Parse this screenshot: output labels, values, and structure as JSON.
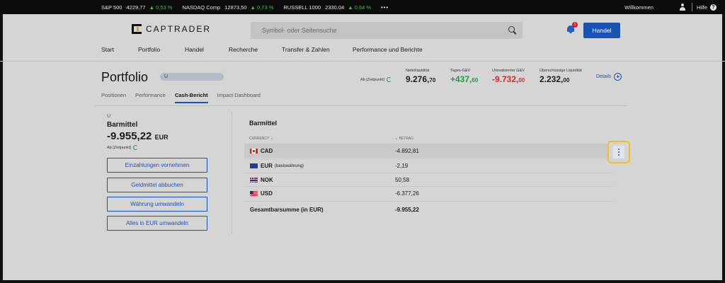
{
  "ticker": {
    "items": [
      {
        "name": "S&P 500",
        "value": "4229,77",
        "change": "▲ 0,53 %"
      },
      {
        "name": "NASDAQ Comp",
        "value": "12873,50",
        "change": "▲ 0,73 %"
      },
      {
        "name": "RUSSELL 1000",
        "value": "2330,04",
        "change": "▲ 0,54 %"
      }
    ],
    "more": "•••",
    "welcome": "Willkommen",
    "help": "Hilfe",
    "help_icon": "?"
  },
  "header": {
    "logo_text": "CAPTRADER",
    "search_placeholder": "Symbol- oder Seitensuche",
    "notification_count": "1",
    "trade_button": "Handel",
    "nav": [
      "Start",
      "Portfolio",
      "Handel",
      "Recherche",
      "Transfer & Zahlen",
      "Performance und Berichte"
    ]
  },
  "portfolio": {
    "title": "Portfolio",
    "account": "U",
    "as_of": "Ab [Zeitpunkt]",
    "metrics": [
      {
        "label": "Nettoliquidität",
        "main": "9.276,",
        "dec": "70",
        "color": "default"
      },
      {
        "label": "Tages-G&V",
        "main": "+437,",
        "dec": "60",
        "color": "green"
      },
      {
        "label": "Unrealisierter G&V",
        "main": "-9.732,",
        "dec": "00",
        "color": "red"
      },
      {
        "label": "Überschüssige Liquidität",
        "main": "2.232,",
        "dec": "00",
        "color": "default"
      }
    ],
    "details": "Details",
    "tabs": [
      "Positionen",
      "Performance",
      "Cash-Bericht",
      "Impact Dashboard"
    ],
    "active_tab": "Cash-Bericht"
  },
  "cash": {
    "account": "U",
    "title": "Barmittel",
    "amount": "-9.955,22",
    "currency": "EUR",
    "as_of": "Ab [Zeitpunkt]",
    "buttons": [
      "Einzahlungen vornehmen",
      "Geldmittel abbuchen",
      "Währung umwandeln",
      "Alles in EUR umwandeln"
    ]
  },
  "table": {
    "title": "Barmittel",
    "col_currency": "CURRENCY",
    "col_amount": "BETRAG",
    "sort_icon": "⌄",
    "rows": [
      {
        "flag": "ca-flag-icon",
        "code": "CAD",
        "note": "",
        "amount": "-4.892,81"
      },
      {
        "flag": "eu-flag-icon",
        "code": "EUR",
        "note": "(basiswährung)",
        "amount": "-2,19"
      },
      {
        "flag": "no-flag-icon",
        "code": "NOK",
        "note": "",
        "amount": "50,58"
      },
      {
        "flag": "us-flag-icon",
        "code": "USD",
        "note": "",
        "amount": "-6.377,26"
      }
    ],
    "total_label": "Gesamtbarsumme (in EUR)",
    "total_amount": "-9.955,22"
  },
  "colors": {
    "accent": "#1953b5",
    "positive": "#1e9a46",
    "negative": "#d12a2a",
    "highlight": "#f2c01e"
  }
}
